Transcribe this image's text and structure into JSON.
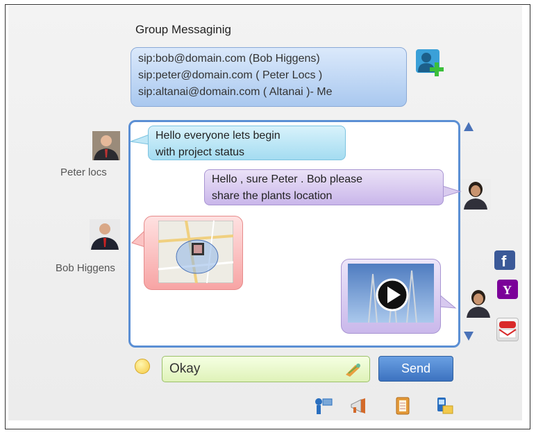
{
  "header": {
    "title": "Group Messaginig"
  },
  "participants": [
    "sip:bob@domain.com (Bob Higgens)",
    "sip:peter@domain.com ( Peter Locs )",
    "sip:altanai@domain.com ( Altanai )- Me"
  ],
  "users": {
    "peter": {
      "name": "Peter locs"
    },
    "bob": {
      "name": "Bob Higgens"
    }
  },
  "messages": [
    {
      "line1": "Hello everyone lets begin",
      "line2": "with project status"
    },
    {
      "line1": "Hello , sure Peter . Bob please",
      "line2": "share the plants location"
    }
  ],
  "composer": {
    "value": "Okay",
    "send_label": "Send"
  },
  "icons": {
    "add_user": "add-user-icon",
    "social": [
      "facebook-icon",
      "yahoo-icon",
      "gmail-icon"
    ],
    "toolbar": [
      "video-call-icon",
      "megaphone-icon",
      "notebook-icon",
      "phone-icon"
    ]
  },
  "colors": {
    "accent": "#5b8fd4",
    "send": "#3c72c0",
    "facebook": "#3b5998",
    "yahoo": "#7b0099"
  }
}
